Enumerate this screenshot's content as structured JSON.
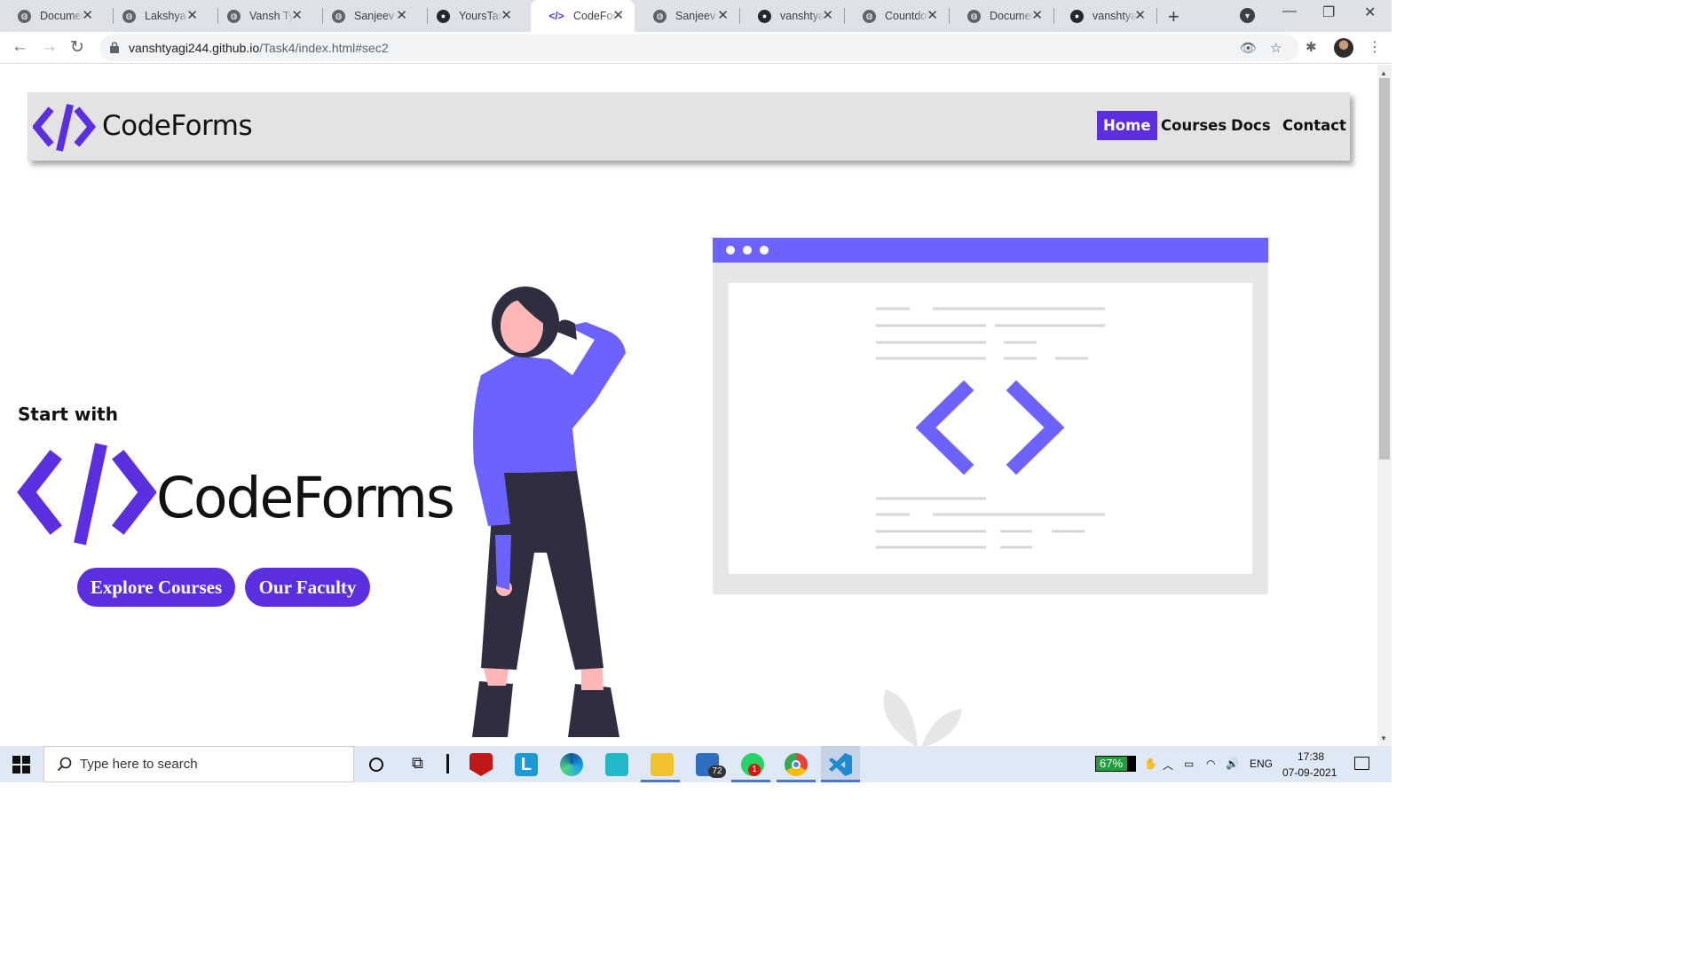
{
  "browser": {
    "tabs": [
      {
        "title": "Documen",
        "favicon": "globe-icon",
        "active": false
      },
      {
        "title": "Lakshya",
        "favicon": "globe-icon",
        "active": false
      },
      {
        "title": "Vansh Tya",
        "favicon": "globe-icon",
        "active": false
      },
      {
        "title": "Sanjeev T",
        "favicon": "globe-icon",
        "active": false
      },
      {
        "title": "YoursTast",
        "favicon": "github-icon",
        "active": false
      },
      {
        "title": "CodeForm",
        "favicon": "code-icon",
        "active": true
      },
      {
        "title": "Sanjeev T",
        "favicon": "globe-icon",
        "active": false
      },
      {
        "title": "vanshtyac",
        "favicon": "github-icon",
        "active": false
      },
      {
        "title": "Countdov",
        "favicon": "globe-icon",
        "active": false
      },
      {
        "title": "Documen",
        "favicon": "globe-icon",
        "active": false
      },
      {
        "title": "vanshtyac",
        "favicon": "github-icon",
        "active": false
      }
    ],
    "address": {
      "host": "vanshtyagi244.github.io",
      "path": "/Task4/index.html#sec2"
    }
  },
  "site": {
    "brand": "CodeForms",
    "nav": [
      "Home",
      "Courses",
      "Docs",
      "Contact"
    ],
    "active_nav": "Home",
    "accent_color": "#5b2ee0",
    "illustration_color": "#6c63ff",
    "hero": {
      "start_text": "Start with",
      "brand": "CodeForms",
      "buttons": [
        "Explore Courses",
        "Our Faculty"
      ]
    }
  },
  "taskbar": {
    "search_placeholder": "Type here to search",
    "battery": "67%",
    "language": "ENG",
    "time": "17:38",
    "date": "07-09-2021",
    "mail_badge": "72",
    "whatsapp_badge": "1"
  }
}
